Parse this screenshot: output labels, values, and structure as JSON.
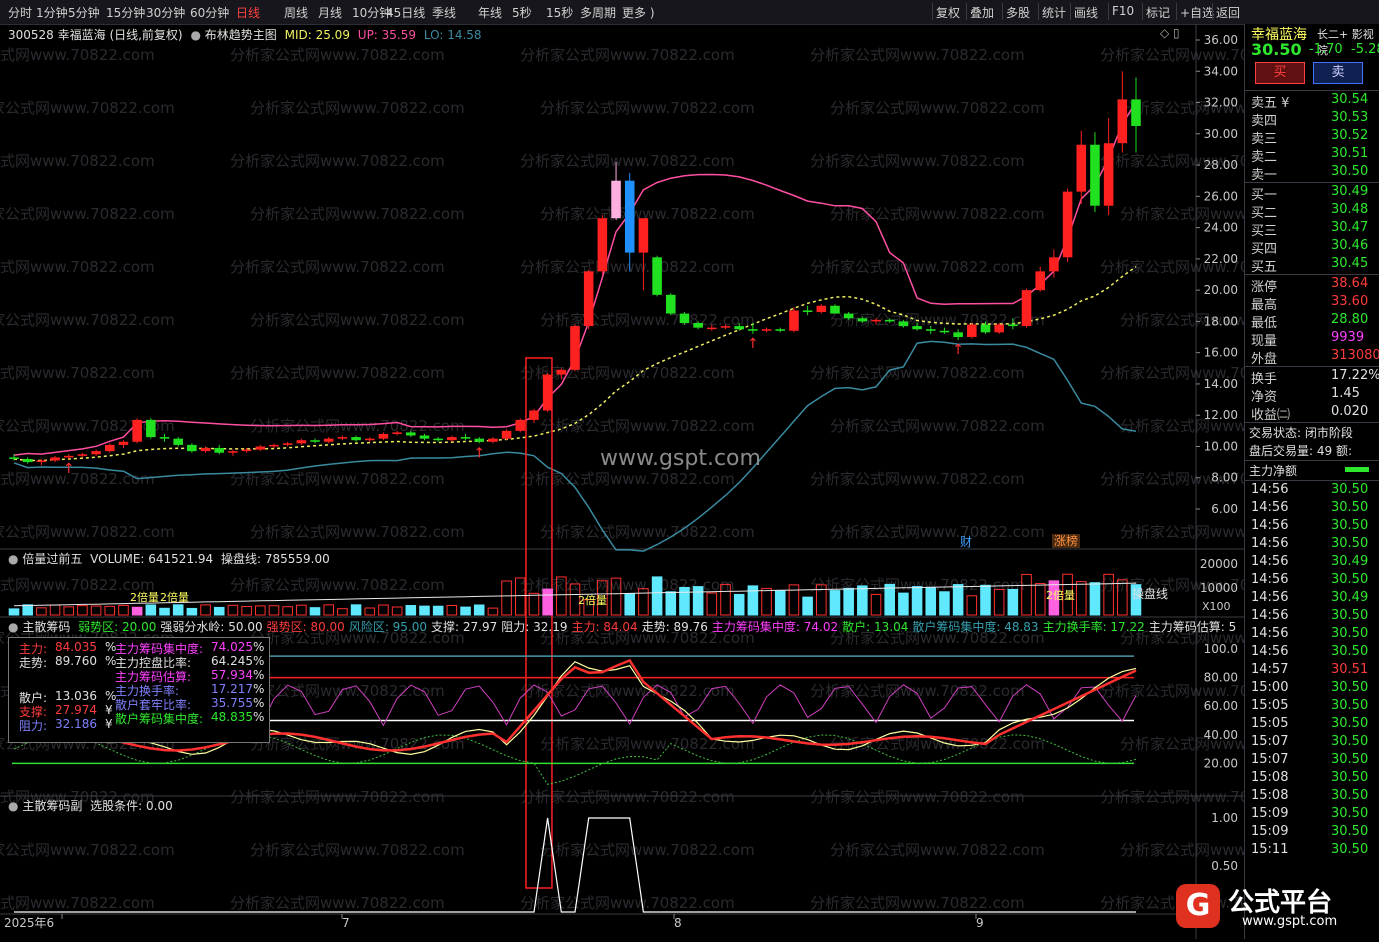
{
  "toolbar": {
    "periods": [
      "分时",
      "1分钟",
      "5分钟",
      "15分钟",
      "30分钟",
      "60分钟",
      "日线",
      "周线",
      "月线",
      "10分钟",
      "45日线",
      "季线",
      "年线",
      "5秒",
      "15秒",
      "多周期",
      "更多 )"
    ],
    "active_period": "日线",
    "right_items": [
      "复权",
      "叠加",
      "多股",
      "统计",
      "画线",
      "F10",
      "标记",
      "+自选",
      "返回"
    ]
  },
  "main": {
    "code_name": "300528 幸福蓝海 (日线,前复权)",
    "indicator": "布林趋势主图",
    "mid_label": "MID: 25.09",
    "up_label": "UP: 35.59",
    "lo_label": "LO: 14.58",
    "price_ticks": [
      "36.00",
      "34.00",
      "32.00",
      "30.00",
      "28.00",
      "26.00",
      "24.00",
      "22.00",
      "20.00",
      "18.00",
      "16.00",
      "14.00",
      "12.00",
      "10.00",
      "8.00",
      "6.00"
    ],
    "watermark": "www.gspt.com",
    "bg_watermark": "分析家公式网www.70822.com",
    "tag_cai": "财",
    "tag_zhangbang": "涨榜",
    "arrow_glyph": "↑",
    "colors": {
      "up": "#ff2020",
      "down": "#20e020",
      "pink": "#ff4fa0",
      "lo": "#3a8aa0",
      "mid": "#f0f060"
    }
  },
  "volume": {
    "title": "倍量过前五",
    "volume_label": "VOLUME: 641521.94",
    "pan_label": "操盘线: 785559.00",
    "ticks": [
      "20000",
      "10000"
    ],
    "unit": "X100",
    "beiliang_labels": [
      "2倍量",
      "2倍量",
      "2倍量",
      "2倍量"
    ],
    "caopan_label": "操盘线"
  },
  "indicator1": {
    "title": "主散筹码",
    "items": [
      {
        "t": "弱势区: 20.00",
        "c": "green"
      },
      {
        "t": "强弱分水岭: 50.00",
        "c": "white"
      },
      {
        "t": "强势区: 80.00",
        "c": "red"
      },
      {
        "t": "风险区: 95.00",
        "c": "teal"
      },
      {
        "t": "支撑: 27.97",
        "c": "white"
      },
      {
        "t": "阻力: 32.19",
        "c": "white"
      },
      {
        "t": "主力: 84.04",
        "c": "red"
      },
      {
        "t": "走势: 89.76",
        "c": "white"
      },
      {
        "t": "主力筹码集中度: 74.02",
        "c": "mag"
      },
      {
        "t": "散户: 13.04",
        "c": "green"
      },
      {
        "t": "散户筹码集中度: 48.83",
        "c": "teal"
      },
      {
        "t": "主力换手率: 17.22",
        "c": "green"
      },
      {
        "t": "主力筹码估算: 5",
        "c": "white"
      }
    ],
    "ticks": [
      "100.0",
      "80.00",
      "60.00",
      "40.00",
      "20.00"
    ],
    "box": [
      {
        "l": "主力:",
        "v": "84.035",
        "u": "%",
        "c": "red"
      },
      {
        "l": "走势:",
        "v": "89.760",
        "u": "%",
        "c": "white"
      },
      {
        "l": "散户:",
        "v": "13.036",
        "u": "%",
        "c": "white"
      },
      {
        "l": "支撑:",
        "v": "27.974",
        "u": "¥",
        "c": "red"
      },
      {
        "l": "阻力:",
        "v": "32.186",
        "u": "¥",
        "c": "blue"
      }
    ],
    "box2": [
      {
        "l": "主力筹码集中度:",
        "v": "74.025",
        "u": "%",
        "c": "mag"
      },
      {
        "l": "主力控盘比率:",
        "v": "64.245",
        "u": "%",
        "c": "white"
      },
      {
        "l": "主力筹码估算:",
        "v": "57.934",
        "u": "%",
        "c": "mag"
      },
      {
        "l": "主力换手率:",
        "v": "17.217",
        "u": "%",
        "c": "blue"
      },
      {
        "l": "散户套牢比率:",
        "v": "35.755",
        "u": "%",
        "c": "blue"
      },
      {
        "l": "散户筹码集中度:",
        "v": "48.835",
        "u": "%",
        "c": "green"
      }
    ]
  },
  "indicator2": {
    "title": "主散筹码副",
    "condition": "选股条件: 0.00",
    "ticks": [
      "1.00",
      "0.50"
    ]
  },
  "xaxis": {
    "labels": [
      "2025年6",
      "7",
      "8",
      "9"
    ]
  },
  "right": {
    "name": "幸福蓝海",
    "extra": "⻓二+ 影视院",
    "price": "30.50",
    "change": "-1.70",
    "pct": "-5.28",
    "buy_btn": "买",
    "sell_btn": "卖",
    "sells": [
      {
        "l": "卖五 ¥",
        "v": "30.54",
        "c": "green"
      },
      {
        "l": "卖四",
        "v": "30.53",
        "c": "green"
      },
      {
        "l": "卖三",
        "v": "30.52",
        "c": "green"
      },
      {
        "l": "卖二",
        "v": "30.51",
        "c": "green"
      },
      {
        "l": "卖一",
        "v": "30.50",
        "c": "green"
      }
    ],
    "buys": [
      {
        "l": "买一",
        "v": "30.49",
        "c": "green"
      },
      {
        "l": "买二",
        "v": "30.48",
        "c": "green"
      },
      {
        "l": "买三",
        "v": "30.47",
        "c": "green"
      },
      {
        "l": "买四",
        "v": "30.46",
        "c": "green"
      },
      {
        "l": "买五",
        "v": "30.45",
        "c": "green"
      }
    ],
    "stats": [
      {
        "l": "涨停",
        "v": "38.64",
        "c": "red"
      },
      {
        "l": "最高",
        "v": "33.60",
        "c": "red"
      },
      {
        "l": "最低",
        "v": "28.80",
        "c": "green"
      },
      {
        "l": "现量",
        "v": "9939",
        "c": "mag"
      },
      {
        "l": "外盘",
        "v": "313080",
        "c": "red"
      }
    ],
    "stats2": [
      {
        "l": "换手",
        "v": "17.22%",
        "c": "white"
      },
      {
        "l": "净资",
        "v": "1.45",
        "c": "white"
      },
      {
        "l": "收益㈡",
        "v": "0.020",
        "c": "white"
      }
    ],
    "status": "交易状态: 闭市阶段",
    "after": "盘后交易量: 49  额:",
    "net": "主力净额",
    "ticks": [
      [
        "14:56",
        "30.50",
        "green"
      ],
      [
        "14:56",
        "30.50",
        "green"
      ],
      [
        "14:56",
        "30.50",
        "green"
      ],
      [
        "14:56",
        "30.50",
        "green"
      ],
      [
        "14:56",
        "30.49",
        "green"
      ],
      [
        "14:56",
        "30.50",
        "green"
      ],
      [
        "14:56",
        "30.49",
        "green"
      ],
      [
        "14:56",
        "30.50",
        "green"
      ],
      [
        "14:56",
        "30.50",
        "green"
      ],
      [
        "14:56",
        "30.50",
        "green"
      ],
      [
        "14:57",
        "30.51",
        "red"
      ],
      [
        "15:00",
        "30.50",
        "green"
      ],
      [
        "15:05",
        "30.50",
        "green"
      ],
      [
        "15:05",
        "30.50",
        "green"
      ],
      [
        "15:07",
        "30.50",
        "green"
      ],
      [
        "15:07",
        "30.50",
        "green"
      ],
      [
        "15:08",
        "30.50",
        "green"
      ],
      [
        "15:08",
        "30.50",
        "green"
      ],
      [
        "15:09",
        "30.50",
        "green"
      ],
      [
        "15:09",
        "30.50",
        "green"
      ],
      [
        "15:11",
        "30.50",
        "green"
      ]
    ]
  },
  "logo": {
    "text": "公式平台",
    "url": "www.gspt.com"
  }
}
